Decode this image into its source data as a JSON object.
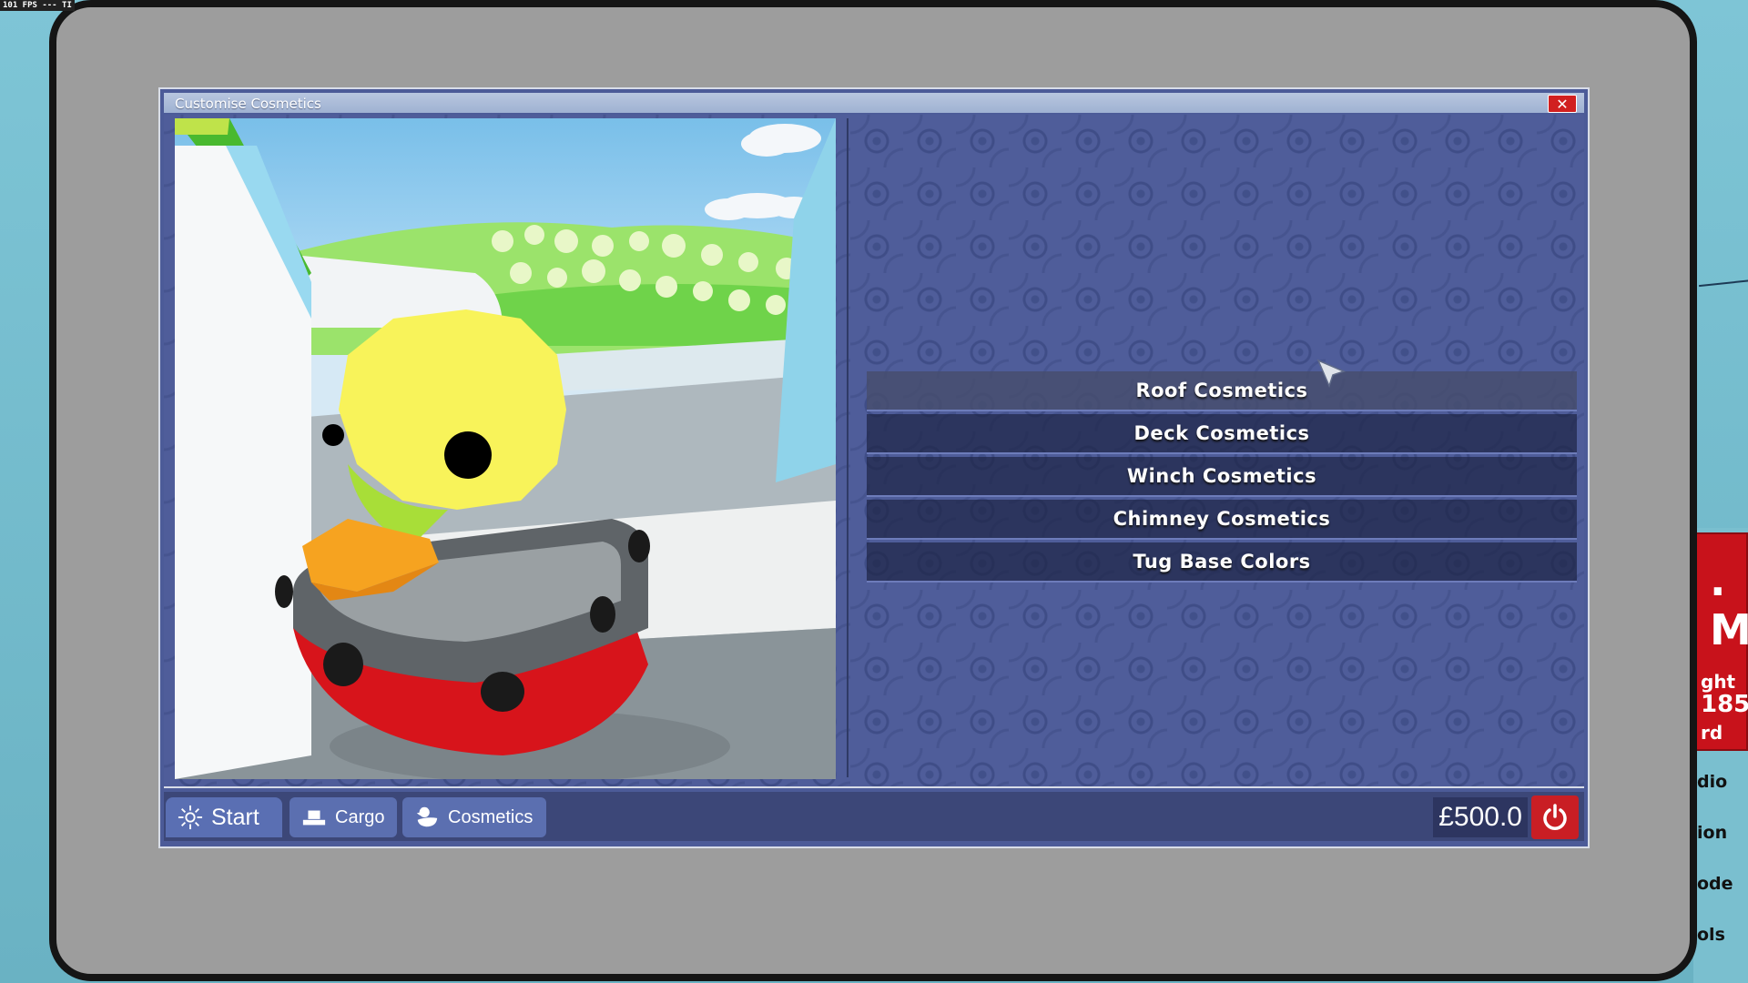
{
  "hud": {
    "fps_text": "101 FPS --- TI"
  },
  "world": {
    "sign_big": ". M",
    "sign_lines": [
      "ght",
      "185",
      "rd"
    ],
    "side_labels": [
      "dio",
      "ion",
      "ode",
      "ols"
    ]
  },
  "window": {
    "title": "Customise Cosmetics",
    "close_glyph": "✕"
  },
  "menu": {
    "items": [
      {
        "label": "Roof Cosmetics",
        "hovered": true
      },
      {
        "label": "Deck Cosmetics",
        "hovered": false
      },
      {
        "label": "Winch Cosmetics",
        "hovered": false
      },
      {
        "label": "Chimney Cosmetics",
        "hovered": false
      },
      {
        "label": "Tug Base Colors",
        "hovered": false
      }
    ]
  },
  "taskbar": {
    "start_label": "Start",
    "cargo_label": "Cargo",
    "cosmetics_label": "Cosmetics",
    "money": "£500.0",
    "icons": {
      "start": "sun-icon",
      "cargo": "cargo-icon",
      "cosmetics": "duck-icon",
      "power": "power-icon"
    }
  },
  "colors": {
    "window_bg": "#4c5b98",
    "taskbar_bg": "#3c4778",
    "button_bg": "#5b6fb0",
    "close_red": "#d12020",
    "power_red": "#c91e24",
    "bezel": "#9d9d9d"
  }
}
